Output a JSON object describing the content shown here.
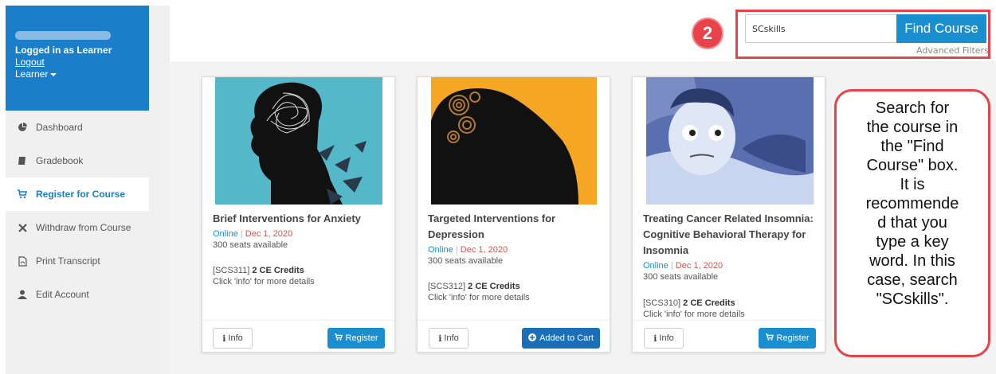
{
  "sidebar": {
    "logged_in": "Logged in as Learner",
    "logout": "Logout",
    "role": "Learner",
    "items": [
      {
        "label": "Dashboard",
        "icon": "pie-chart-icon"
      },
      {
        "label": "Gradebook",
        "icon": "book-icon"
      },
      {
        "label": "Register for Course",
        "icon": "cart-icon",
        "active": true
      },
      {
        "label": "Withdraw from Course",
        "icon": "close-icon"
      },
      {
        "label": "Print Transcript",
        "icon": "pdf-icon"
      },
      {
        "label": "Edit Account",
        "icon": "user-icon"
      }
    ]
  },
  "search": {
    "step": "2",
    "value": "SCskills",
    "button": "Find Course",
    "advanced": "Advanced Filters"
  },
  "cards": [
    {
      "title": "Brief Interventions for Anxiety",
      "online": "Online",
      "sep": "|",
      "date": "Dec 1, 2020",
      "seats": "300 seats available",
      "code": "[SCS311]",
      "credits": "2 CE Credits",
      "details": "Click 'info' for more details",
      "info": "Info",
      "action": "Register"
    },
    {
      "title": "Targeted Interventions for Depression",
      "online": "Online",
      "sep": "|",
      "date": "Dec 1, 2020",
      "seats": "300 seats available",
      "code": "[SCS312]",
      "credits": "2 CE Credits",
      "details": "Click 'info' for more details",
      "info": "Info",
      "action": "Added to Cart"
    },
    {
      "title": "Treating Cancer Related Insomnia: Cognitive Behavioral Therapy for Insomnia",
      "online": "Online",
      "sep": "|",
      "date": "Dec 1, 2020",
      "seats": "300 seats available",
      "code": "[SCS310]",
      "credits": "2 CE Credits",
      "details": "Click 'info' for more details",
      "info": "Info",
      "action": "Register"
    }
  ],
  "callout": {
    "lines": [
      "Search for",
      "the course in",
      "the \"Find",
      "Course\" box.",
      "It is",
      "recommende",
      "d that you",
      "type a key",
      "word. In this",
      "case, search",
      "\"SCskills\"."
    ]
  },
  "colors": {
    "accent": "#1a8fd0",
    "highlight": "#e8424a",
    "sidebar_header": "#1a7fc8"
  }
}
